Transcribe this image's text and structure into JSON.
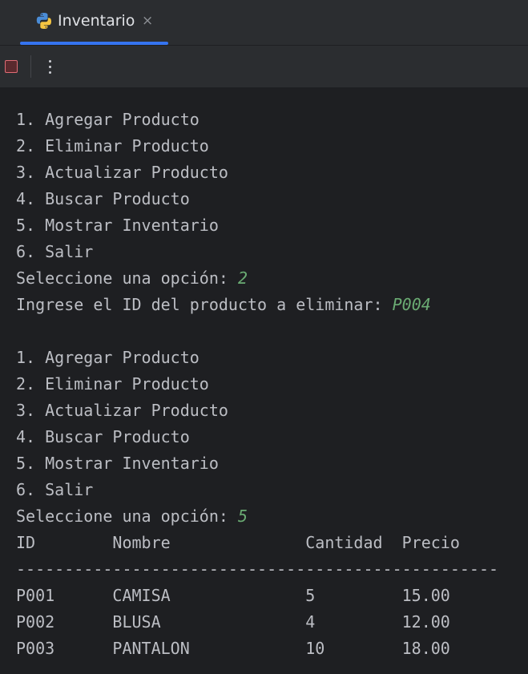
{
  "tab": {
    "title": "Inventario",
    "close_glyph": "×",
    "icon": "python-icon"
  },
  "toolbar": {
    "stop_icon": "stop-icon",
    "more_icon": "more-vertical-icon"
  },
  "colors": {
    "accent": "#3574f0",
    "input_echo": "#6aab73",
    "text": "#bcbec4",
    "stop": "#e06c75"
  },
  "console": {
    "menu1": [
      "1. Agregar Producto",
      "2. Eliminar Producto",
      "3. Actualizar Producto",
      "4. Buscar Producto",
      "5. Mostrar Inventario",
      "6. Salir"
    ],
    "prompt1": "Seleccione una opción: ",
    "input1": "2",
    "prompt_id": "Ingrese el ID del producto a eliminar: ",
    "input_id": "P004",
    "menu2": [
      "1. Agregar Producto",
      "2. Eliminar Producto",
      "3. Actualizar Producto",
      "4. Buscar Producto",
      "5. Mostrar Inventario",
      "6. Salir"
    ],
    "prompt2": "Seleccione una opción: ",
    "input2": "5",
    "table": {
      "header": "ID        Nombre              Cantidad  Precio",
      "separator": "--------------------------------------------------",
      "rows": [
        "P001      CAMISA              5         15.00",
        "P002      BLUSA               4         12.00",
        "P003      PANTALON            10        18.00"
      ]
    }
  }
}
